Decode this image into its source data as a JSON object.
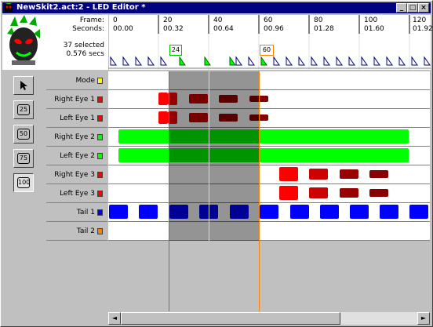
{
  "window": {
    "title": "NewSkit2.act:2 - LED Editor *"
  },
  "header": {
    "frame_label": "Frame:",
    "seconds_label": "Seconds:",
    "selected_count": "37 selected",
    "selected_duration": "0.576 secs",
    "frames": [
      "0",
      "20",
      "40",
      "60",
      "80",
      "100",
      "120"
    ],
    "seconds": [
      "00.00",
      "00.32",
      "00.64",
      "00.96",
      "01.28",
      "01.60",
      "01.92"
    ],
    "marker_start": "24",
    "marker_end": "60"
  },
  "tools": [
    {
      "name": "pointer",
      "label": ""
    },
    {
      "name": "25",
      "label": "25"
    },
    {
      "name": "50",
      "label": "50"
    },
    {
      "name": "75",
      "label": "75"
    },
    {
      "name": "100",
      "label": "100"
    }
  ],
  "tracks": [
    {
      "label": "Mode",
      "color": "#ffff00"
    },
    {
      "label": "Right Eye 1",
      "color": "#ff0000"
    },
    {
      "label": "Left Eye 1",
      "color": "#ff0000"
    },
    {
      "label": "Right Eye 2",
      "color": "#00ff00"
    },
    {
      "label": "Left Eye 2",
      "color": "#00ff00"
    },
    {
      "label": "Right Eye 3",
      "color": "#ff0000"
    },
    {
      "label": "Left Eye 3",
      "color": "#ff0000"
    },
    {
      "label": "Tail 1",
      "color": "#0000ff"
    },
    {
      "label": "Tail 2",
      "color": "#ff8000"
    }
  ],
  "colors": {
    "selection_start_line": "#00c000",
    "selection_end_line": "#ff8000",
    "red_bright": "#ff0000",
    "red_mid": "#cc0000",
    "red_dark": "#990000",
    "red_darker": "#880000",
    "green": "#00ff00",
    "blue": "#0000ff"
  }
}
